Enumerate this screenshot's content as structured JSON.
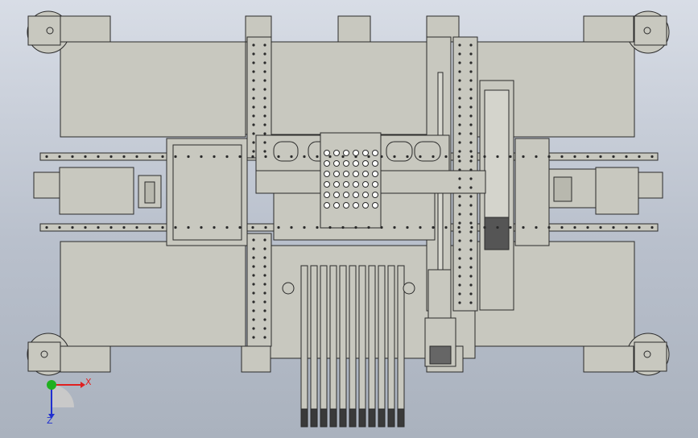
{
  "viewport": {
    "background_top": "#d8dde6",
    "background_bottom": "#aab2be",
    "part_fill": "#c8c8bf",
    "part_fill_dark": "#b8b8ae",
    "edge_color": "#2a2a2a"
  },
  "triad": {
    "x_label": "X",
    "z_label": "Z",
    "x_color": "#e02020",
    "y_color": "#20b020",
    "z_color": "#2030d0"
  }
}
